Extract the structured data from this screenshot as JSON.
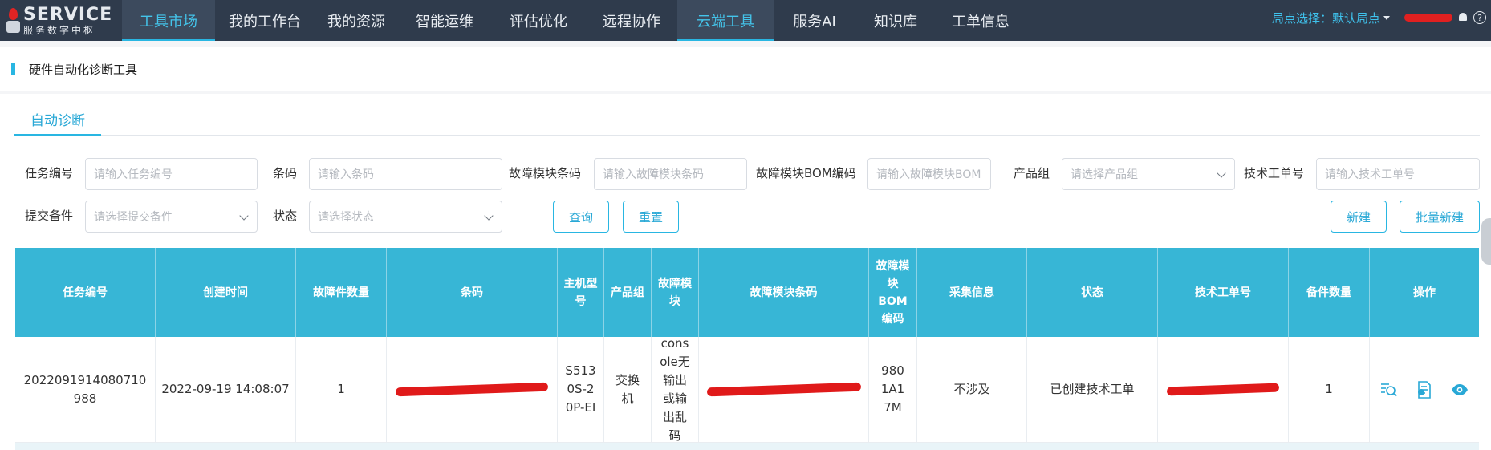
{
  "logo": {
    "line1": "SERVICE",
    "line2": "服务数字中枢"
  },
  "nav": {
    "items": [
      {
        "label": "工具市场",
        "active": true
      },
      {
        "label": "我的工作台",
        "active": false
      },
      {
        "label": "我的资源",
        "active": false
      },
      {
        "label": "智能运维",
        "active": false
      },
      {
        "label": "评估优化",
        "active": false
      },
      {
        "label": "远程协作",
        "active": false
      },
      {
        "label": "云端工具",
        "active": true
      },
      {
        "label": "服务AI",
        "active": false
      },
      {
        "label": "知识库",
        "active": false
      },
      {
        "label": "工单信息",
        "active": false
      }
    ],
    "site_select": "局点选择：默认局点"
  },
  "breadcrumb": {
    "title": "硬件自动化诊断工具"
  },
  "tabs": [
    {
      "label": "自动诊断"
    }
  ],
  "filters": {
    "task_no": {
      "label": "任务编号",
      "placeholder": "请输入任务编号"
    },
    "barcode": {
      "label": "条码",
      "placeholder": "请输入条码"
    },
    "fault_module_barcode": {
      "label": "故障模块条码",
      "placeholder": "请输入故障模块条码"
    },
    "fault_module_bom": {
      "label": "故障模块BOM编码",
      "placeholder": "请输入故障模块BOM"
    },
    "product_group": {
      "label": "产品组",
      "placeholder": "请选择产品组"
    },
    "tech_order_no": {
      "label": "技术工单号",
      "placeholder": "请输入技术工单号"
    },
    "submit_spare": {
      "label": "提交备件",
      "placeholder": "请选择提交备件"
    },
    "status": {
      "label": "状态",
      "placeholder": "请选择状态"
    }
  },
  "buttons": {
    "query": "查询",
    "reset": "重置",
    "create": "新建",
    "batch_create": "批量新建"
  },
  "table": {
    "headers": {
      "task_no": "任务编号",
      "created": "创建时间",
      "fault_count": "故障件数量",
      "barcode": "条码",
      "host_model": "主机型号",
      "product_group": "产品组",
      "fault_module": "故障模块",
      "fault_module_barcode": "故障模块条码",
      "fault_module_bom": "故障模块BOM编码",
      "collect_info": "采集信息",
      "status": "状态",
      "tech_order_no": "技术工单号",
      "spare_count": "备件数量",
      "actions": "操作"
    },
    "rows": [
      {
        "task_no": "2022091914080710988",
        "created": "2022-09-19 14:08:07",
        "fault_count": "1",
        "host_model": "S5130S-20P-EI",
        "product_group": "交换机",
        "fault_module": "console无输出或输出乱码",
        "fault_module_bom": "9801A17M",
        "collect_info": "不涉及",
        "status": "已创建技术工单",
        "spare_count": "1"
      }
    ]
  },
  "colors": {
    "nav_bg": "#2f3b4c",
    "accent": "#29b6e2",
    "table_header": "#37b6d6",
    "redaction": "#e01a1a"
  },
  "icons": [
    "search-icon",
    "caret-down-icon",
    "bell-icon",
    "help-icon",
    "chevron-down-icon",
    "log-search-icon",
    "report-icon",
    "view-icon"
  ]
}
